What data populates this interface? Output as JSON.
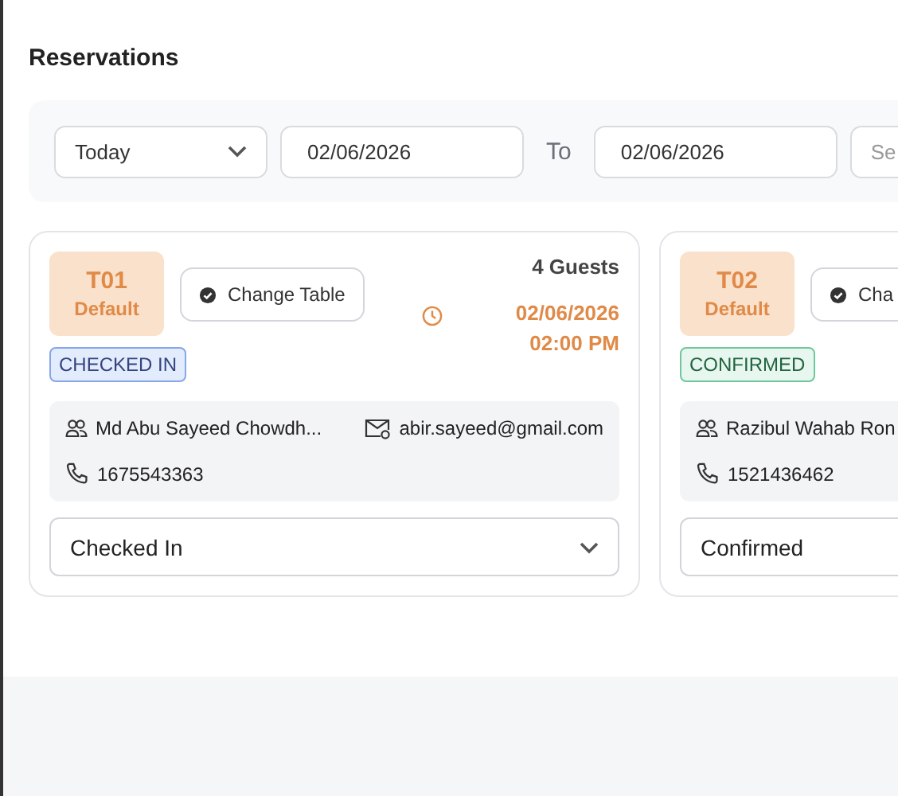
{
  "page": {
    "title": "Reservations"
  },
  "filters": {
    "range": "Today",
    "from": "02/06/2026",
    "separator": "To",
    "to": "02/06/2026",
    "search": {
      "placeholder": "Se"
    }
  },
  "reservations": [
    {
      "table": "T01",
      "section": "Default",
      "action": "Change Table",
      "guests": "4 Guests",
      "date": "02/06/2026",
      "time": "02:00 PM",
      "status": {
        "label": "CHECKED IN",
        "kind": "checked_in"
      },
      "name": "Md Abu Sayeed Chowdh...",
      "email": "abir.sayeed@gmail.com",
      "phone": "1675543363",
      "select": "Checked In"
    },
    {
      "table": "T02",
      "section": "Default",
      "action": "Cha",
      "status": {
        "label": "CONFIRMED",
        "kind": "confirmed"
      },
      "name": "Razibul Wahab Ron",
      "phone": "1521436462",
      "select": "Confirmed"
    }
  ]
}
